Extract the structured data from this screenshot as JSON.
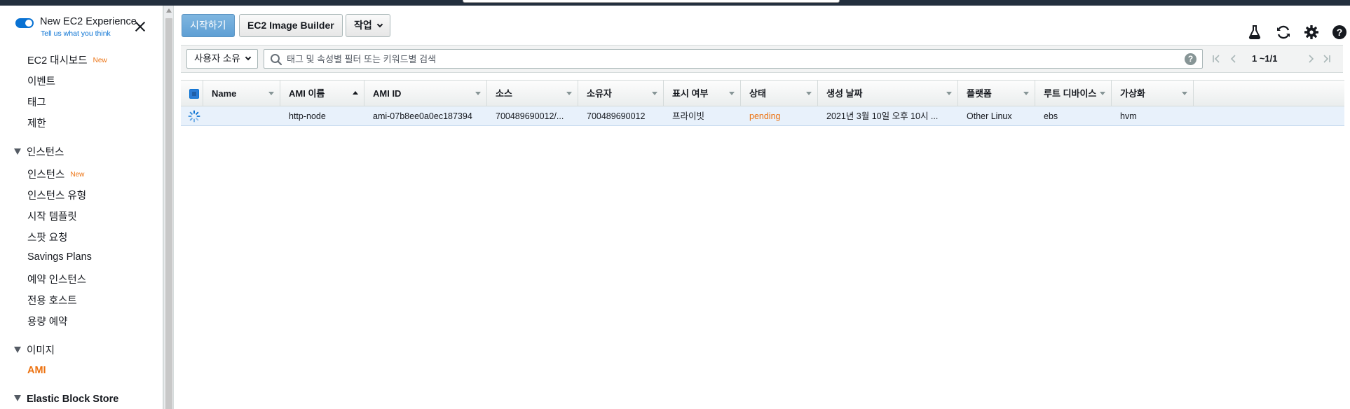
{
  "experience": {
    "title": "New EC2 Experience",
    "subtitle": "Tell us what you think"
  },
  "sidebar": {
    "items": [
      {
        "label": "EC2 대시보드",
        "badge": "New"
      },
      {
        "label": "이벤트"
      },
      {
        "label": "태그"
      },
      {
        "label": "제한"
      }
    ],
    "sections": [
      {
        "label": "인스턴스"
      },
      {
        "label": "이미지"
      },
      {
        "label": "Elastic Block Store"
      }
    ],
    "instances_items": [
      {
        "label": "인스턴스",
        "badge": "New"
      },
      {
        "label": "인스턴스 유형"
      },
      {
        "label": "시작 템플릿"
      },
      {
        "label": "스팟 요청"
      },
      {
        "label": "Savings Plans"
      },
      {
        "label": "예약 인스턴스"
      },
      {
        "label": "전용 호스트"
      },
      {
        "label": "용량 예약"
      }
    ],
    "images_items": [
      {
        "label": "AMI"
      }
    ]
  },
  "toolbar": {
    "launch_label": "시작하기",
    "image_builder_label": "EC2 Image Builder",
    "actions_label": "작업"
  },
  "filter": {
    "owner_label": "사용자 소유",
    "search_placeholder": "태그 및 속성별 필터 또는 키워드별 검색",
    "help_label": "?"
  },
  "pager": {
    "text": "1 ~1/1"
  },
  "table": {
    "columns": [
      "Name",
      "AMI 이름",
      "AMI ID",
      "소스",
      "소유자",
      "표시 여부",
      "상태",
      "생성 날짜",
      "플랫폼",
      "루트 디바이스",
      "가상화"
    ],
    "rows": [
      {
        "name": "",
        "ami_name": "http-node",
        "ami_id": "ami-07b8ee0a0ec187394",
        "source": "700489690012/...",
        "owner": "700489690012",
        "visibility": "프라이빗",
        "status": "pending",
        "created": "2021년 3월 10일 오후 10시 ...",
        "platform": "Other Linux",
        "root_device": "ebs",
        "virtualization": "hvm"
      }
    ]
  },
  "colors": {
    "accent_blue": "#0972d3",
    "accent_orange": "#ec7211",
    "selected_row": "#e8f1fb"
  },
  "icons": [
    "flask-icon",
    "refresh-icon",
    "gear-icon",
    "help-icon"
  ]
}
